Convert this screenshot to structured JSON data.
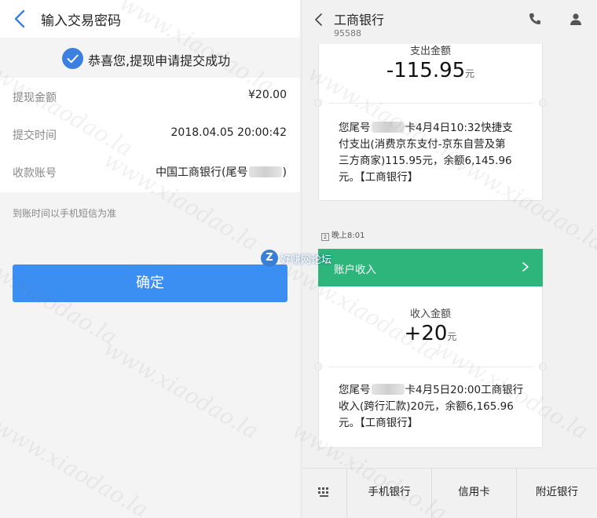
{
  "left": {
    "header_title": "输入交易密码",
    "success_message": "恭喜您,提现申请提交成功",
    "rows": [
      {
        "label": "提现金额",
        "value": "¥20.00"
      },
      {
        "label": "提交时间",
        "value": "2018.04.05 20:00:42"
      },
      {
        "label": "收款账号",
        "value_prefix": "中国工商银行(尾号",
        "value_suffix": ")"
      }
    ],
    "note": "到账时间以手机短信为准",
    "confirm_label": "确定"
  },
  "right": {
    "bank_name": "工商银行",
    "bank_number": "95588",
    "card1": {
      "amount_label": "支出金额",
      "amount": "-115.95",
      "unit": "元",
      "message_lines": [
        [
          "您尾号",
          "卡4月4日10:32快捷支"
        ],
        [
          "付支出(消费京东支付-京东自营及第"
        ],
        [
          "三方商家)115.95元，余额6,145.96"
        ],
        [
          "元。【工商银行】"
        ]
      ]
    },
    "time_tag_sim": "2",
    "time_tag": "晚上8:01",
    "green_bar_label": "账户收入",
    "card2": {
      "amount_label": "收入金额",
      "amount": "+20",
      "unit": "元",
      "message_lines": [
        [
          "您尾号",
          "卡4月5日20:00工商银行"
        ],
        [
          "收入(跨行汇款)20元，余额6,165.96"
        ],
        [
          "元。【工商银行】"
        ]
      ]
    },
    "bottom_tabs": [
      "手机银行",
      "信用卡",
      "附近银行"
    ]
  },
  "watermark": {
    "text": "www.xiaodao.la",
    "logo_letter": "Z",
    "logo_text": "好赚网论坛"
  },
  "colors": {
    "primary_blue": "#3b8ef2",
    "check_blue": "#3b7fe0",
    "income_green": "#2db57b"
  }
}
